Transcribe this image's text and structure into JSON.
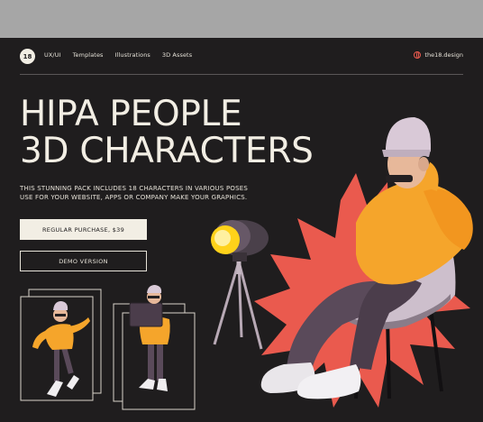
{
  "nav": {
    "logo": "18",
    "links": [
      "UX/UI",
      "Templates",
      "Illustrations",
      "3D Assets"
    ],
    "site": "the18.design"
  },
  "hero": {
    "title_line1": "HIPA PEOPLE",
    "title_line2": "3D CHARACTERS",
    "desc_line1": "THIS STUNNING PACK INCLUDES 18 CHARACTERS IN VARIOUS POSES",
    "desc_line2": "USE FOR YOUR WEBSITE, APPS OR COMPANY MAKE YOUR GRAPHICS."
  },
  "buttons": {
    "purchase": "REGULAR PURCHASE, $39",
    "demo": "DEMO VERSION"
  },
  "colors": {
    "background": "#1f1d1e",
    "accent": "#ea5a4e",
    "text": "#f2eee4",
    "hoodie": "#f5a52b"
  },
  "icons": [
    "globe-icon"
  ]
}
